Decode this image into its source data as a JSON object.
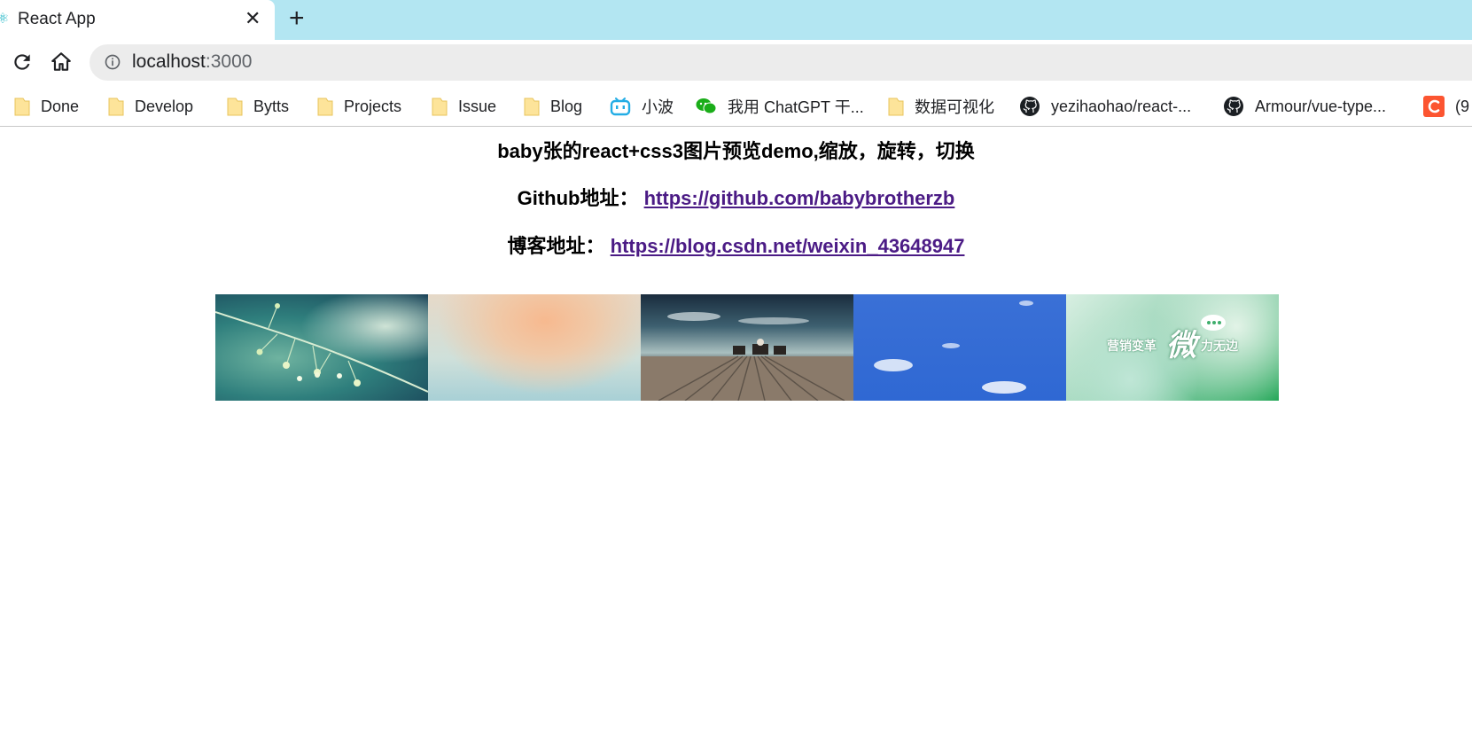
{
  "tab": {
    "title": "React App",
    "close_icon": "close-icon",
    "favicon_icon": "react-logo-icon"
  },
  "new_tab_icon": "plus-icon",
  "toolbar": {
    "reload_icon": "reload-icon",
    "home_icon": "home-icon",
    "info_icon": "info-icon"
  },
  "address": {
    "host": "localhost",
    "port": ":3000"
  },
  "bookmarks": [
    {
      "label": "Done",
      "icon": "folder-icon"
    },
    {
      "label": "Develop",
      "icon": "folder-icon"
    },
    {
      "label": "Bytts",
      "icon": "folder-icon"
    },
    {
      "label": "Projects",
      "icon": "folder-icon"
    },
    {
      "label": "Issue",
      "icon": "folder-icon"
    },
    {
      "label": "Blog",
      "icon": "folder-icon"
    },
    {
      "label": "小波",
      "icon": "bilibili-icon"
    },
    {
      "label": "我用 ChatGPT 干...",
      "icon": "wechat-icon"
    },
    {
      "label": "数据可视化",
      "icon": "folder-icon"
    },
    {
      "label": "yezihaohao/react-...",
      "icon": "github-icon"
    },
    {
      "label": "Armour/vue-type...",
      "icon": "github-icon"
    },
    {
      "label": "(9",
      "icon": "csdn-icon"
    }
  ],
  "page": {
    "title": "baby张的react+css3图片预览demo,缩放，旋转，切换",
    "github_label": "Github地址：",
    "github_link": "https://github.com/babybrotherzb",
    "blog_label": "博客地址：",
    "blog_link": "https://blog.csdn.net/weixin_43648947"
  },
  "gallery": {
    "images": [
      {
        "name": "green-plant-thumbnail"
      },
      {
        "name": "pastel-gradient-thumbnail"
      },
      {
        "name": "deck-chairs-sea-thumbnail"
      },
      {
        "name": "blue-sky-clouds-thumbnail"
      },
      {
        "name": "wechat-marketing-thumbnail",
        "caption_left": "营销变革",
        "caption_big": "微",
        "caption_right": "力无边"
      }
    ]
  }
}
